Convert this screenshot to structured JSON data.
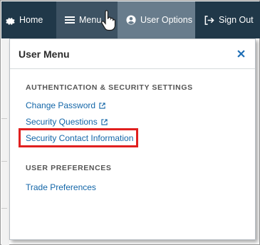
{
  "nav": {
    "home_label": "Home",
    "menu_label": "Menu",
    "user_options_label": "User Options",
    "sign_out_label": "Sign Out"
  },
  "menu_panel": {
    "title": "User Menu",
    "sections": [
      {
        "heading": "AUTHENTICATION & SECURITY SETTINGS",
        "links": [
          {
            "label": "Change Password",
            "external": true
          },
          {
            "label": "Security Questions",
            "external": true
          },
          {
            "label": "Security Contact Information",
            "external": false,
            "highlighted": true
          }
        ]
      },
      {
        "heading": "USER PREFERENCES",
        "links": [
          {
            "label": "Trade Preferences",
            "external": false
          }
        ]
      }
    ]
  },
  "colors": {
    "navbar": "#203849",
    "menu_active": "#3d5263",
    "user_options_bg": "#687c8c",
    "link": "#1366a8",
    "highlight": "#e0201f",
    "close_icon": "#1f6fb6"
  },
  "icons": {
    "home": "gear-icon",
    "menu": "hamburger-icon",
    "user_options": "user-circle-icon",
    "sign_out": "sign-out-icon",
    "cursor": "hand-pointer-icon",
    "close": "close-icon",
    "external": "external-link-icon"
  }
}
